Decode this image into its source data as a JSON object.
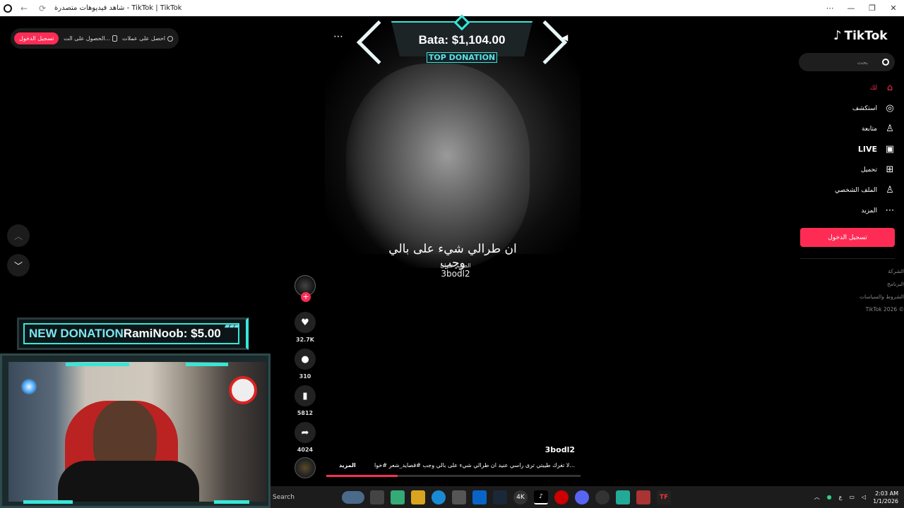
{
  "browser": {
    "title": "شاهد فيديوهات متصدرة - TikTok | TikTok",
    "back": "←",
    "forward": "→",
    "reload": "⟳",
    "controls": [
      "⋯",
      "—",
      "❐",
      "✕"
    ]
  },
  "top_bar": {
    "coins_label": "احصل على عملات",
    "app_label": "الحصول على الت...",
    "login_label": "تسجيل الدخول"
  },
  "video": {
    "caption": "ان طرالي شيء على بالي وجب",
    "watermark_small": "الصمم عنوان",
    "watermark_handle": "3bodl2",
    "author": "3bodl2",
    "description": "لا تغرك طيبتي ترى راسي عنيد ان طرالي شيء على بالي وجب #قصايد_شعر #خوا...",
    "more_label": "المزيد",
    "progress_percent": 28
  },
  "actions": {
    "follow_label": "+",
    "likes": "32.7K",
    "comments": "310",
    "saves": "5812",
    "shares": "4024"
  },
  "top_donation": {
    "name": "Bata: $1,104.00",
    "label": "TOP DONATION"
  },
  "new_donation": {
    "prefix": "NEW DONATION",
    "text": "RamiNoob: $5.00"
  },
  "sidebar": {
    "brand": "TikTok",
    "search_placeholder": "بحث",
    "items": [
      {
        "label": "لك",
        "icon": "home-icon"
      },
      {
        "label": "استكشف",
        "icon": "compass-icon"
      },
      {
        "label": "متابعة",
        "icon": "follow-icon"
      },
      {
        "label": "LIVE",
        "icon": "live-icon"
      },
      {
        "label": "تحميل",
        "icon": "upload-icon"
      },
      {
        "label": "الملف الشخصي",
        "icon": "profile-icon"
      },
      {
        "label": "المزيد",
        "icon": "more-icon"
      }
    ],
    "login_button": "تسجيل الدخول",
    "footer": [
      "الشركة",
      "البرنامج",
      "الشروط والسياسات",
      "TikTok 2026 ©"
    ]
  },
  "taskbar": {
    "search_label": "Search",
    "time": "2:03 AM",
    "date": "1/1/2026",
    "lang": "ع"
  },
  "colors": {
    "accent": "#fe2c55",
    "overlay_cyan": "#38e6d8"
  }
}
